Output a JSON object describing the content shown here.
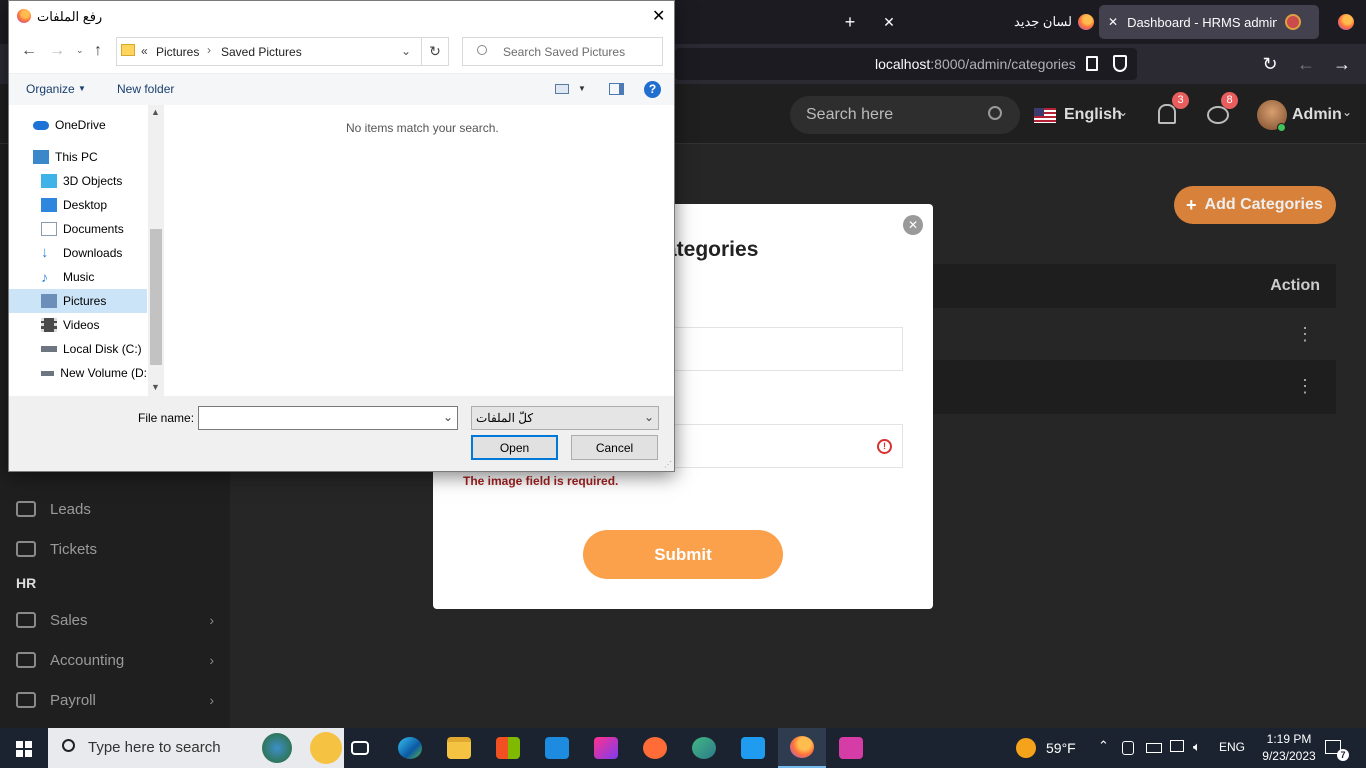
{
  "browser": {
    "tabs": [
      {
        "title": "Dashboard - HRMS admin tem"
      },
      {
        "title": "لسان جديد"
      }
    ],
    "new_tab": "+",
    "close": "✕",
    "url_host": "localhost",
    "url_rest": ":8000/admin/categories"
  },
  "app": {
    "search_placeholder": "Search here",
    "language": "English",
    "notifications_count": "3",
    "messages_count": "8",
    "user_name": "Admin",
    "add_button": "Add Categories",
    "table_action_header": "Action",
    "sidebar": {
      "items": [
        {
          "label": "Leads",
          "chevron": false
        },
        {
          "label": "Tickets",
          "chevron": false
        }
      ],
      "section": "HR",
      "hr_items": [
        {
          "label": "Sales",
          "chevron": true
        },
        {
          "label": "Accounting",
          "chevron": true
        },
        {
          "label": "Payroll",
          "chevron": true
        }
      ]
    },
    "modal": {
      "title_visible": "ategories",
      "error": "The image field is required.",
      "submit": "Submit"
    }
  },
  "dialog": {
    "title": "رفع الملفات",
    "path": [
      "Pictures",
      "Saved Pictures"
    ],
    "path_prefix": "«",
    "search_placeholder": "Search Saved Pictures",
    "organize": "Organize",
    "new_folder": "New folder",
    "empty_message": "No items match your search.",
    "tree": [
      {
        "label": "OneDrive",
        "color": "#1e73d6"
      },
      {
        "label": "This PC",
        "color": "#3a87c9"
      },
      {
        "label": "3D Objects",
        "color": "#3fb3e8"
      },
      {
        "label": "Desktop",
        "color": "#2e86de"
      },
      {
        "label": "Documents",
        "color": "#8c9bb0"
      },
      {
        "label": "Downloads",
        "color": "#2e86de"
      },
      {
        "label": "Music",
        "color": "#2e86de"
      },
      {
        "label": "Pictures",
        "color": "#6b8fb8"
      },
      {
        "label": "Videos",
        "color": "#4a4a4a"
      },
      {
        "label": "Local Disk (C:)",
        "color": "#6d7680"
      },
      {
        "label": "New Volume (D:",
        "color": "#6d7680"
      }
    ],
    "filename_label": "File name:",
    "filename_value": "",
    "filetype": "كلّ الملفات",
    "open": "Open",
    "cancel": "Cancel"
  },
  "taskbar": {
    "search_placeholder": "Type here to search",
    "weather": "59°F",
    "lang": "ENG",
    "time": "1:19 PM",
    "date": "9/23/2023",
    "notif_count": "7"
  }
}
